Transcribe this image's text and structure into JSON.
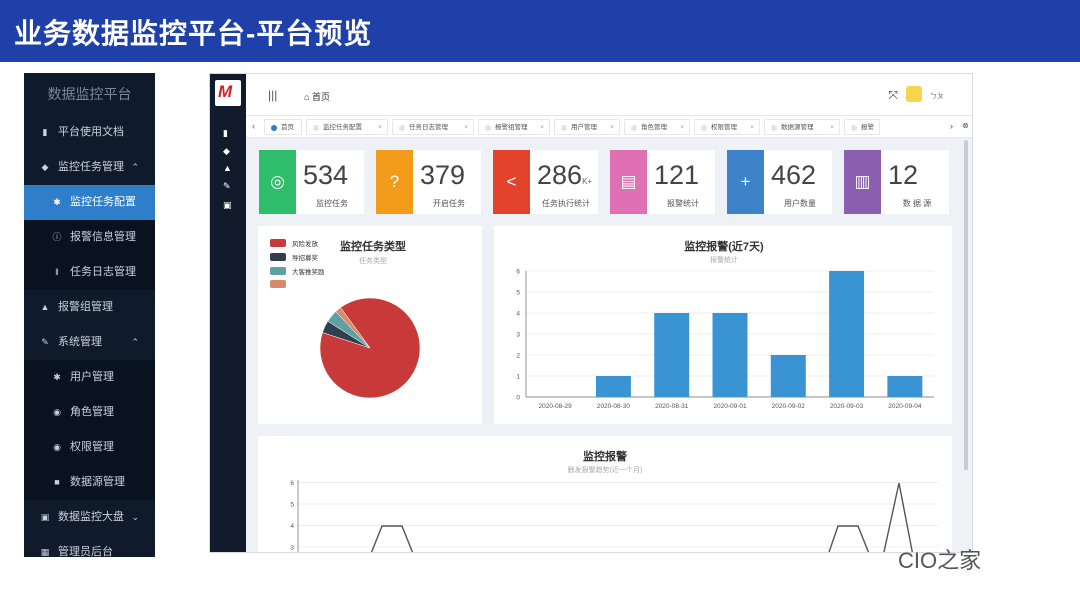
{
  "slide": {
    "title": "业务数据监控平台-平台预览"
  },
  "sidebar": {
    "brand": "数据监控平台",
    "items": [
      {
        "label": "平台使用文档",
        "icon": "book-icon",
        "level": 0
      },
      {
        "label": "监控任务管理",
        "icon": "layers-icon",
        "level": 0,
        "caret": "^"
      },
      {
        "label": "监控任务配置",
        "icon": "gear-icon",
        "level": 1,
        "active": true
      },
      {
        "label": "报警信息管理",
        "icon": "info-icon",
        "level": 1
      },
      {
        "label": "任务日志管理",
        "icon": "log-icon",
        "level": 1
      },
      {
        "label": "报警组管理",
        "icon": "bell-icon",
        "level": 0
      },
      {
        "label": "系统管理",
        "icon": "wrench-icon",
        "level": 0,
        "caret": "^"
      },
      {
        "label": "用户管理",
        "icon": "gear-icon",
        "level": 1
      },
      {
        "label": "角色管理",
        "icon": "users-icon",
        "level": 1
      },
      {
        "label": "权限管理",
        "icon": "users-icon",
        "level": 1
      },
      {
        "label": "数据源管理",
        "icon": "lock-icon",
        "level": 1
      },
      {
        "label": "数据监控大盘",
        "icon": "chart-icon",
        "level": 0,
        "caret": "v"
      },
      {
        "label": "管理员后台",
        "icon": "grid-icon",
        "level": 0
      }
    ]
  },
  "app": {
    "home": "首页",
    "user": "ㄅㄆ",
    "tabs": [
      {
        "label": "首页",
        "active": true
      },
      {
        "label": "监控任务配置"
      },
      {
        "label": "任务日志管理"
      },
      {
        "label": "报警组管理"
      },
      {
        "label": "用户管理"
      },
      {
        "label": "角色管理"
      },
      {
        "label": "权限管理"
      },
      {
        "label": "数据源管理"
      },
      {
        "label": "报警"
      }
    ],
    "stats": [
      {
        "value": "534",
        "suffix": "",
        "label": "监控任务",
        "color": "#2ebd6b",
        "icon": "target-icon"
      },
      {
        "value": "379",
        "suffix": "",
        "label": "开启任务",
        "color": "#f39c1b",
        "icon": "question-icon"
      },
      {
        "value": "286",
        "suffix": "K+",
        "label": "任务执行统计",
        "color": "#e2432a",
        "icon": "share-icon"
      },
      {
        "value": "121",
        "suffix": "",
        "label": "报警统计",
        "color": "#e070b4",
        "icon": "message-icon"
      },
      {
        "value": "462",
        "suffix": "",
        "label": "用户数量",
        "color": "#3c83c9",
        "icon": "add-user-icon"
      },
      {
        "value": "12",
        "suffix": "",
        "label": "数 据 源",
        "color": "#8a5fb1",
        "icon": "map-icon"
      }
    ]
  },
  "chart_data": [
    {
      "type": "pie",
      "title": "监控任务类型",
      "subtitle": "任务类型",
      "legend": [
        "风险发放",
        "导招募奖",
        "大客推奖励",
        ""
      ],
      "colors": [
        "#c83a3a",
        "#2f3f4e",
        "#5fa0a3",
        "#d98a6a"
      ],
      "values": [
        90,
        4,
        4,
        2
      ]
    },
    {
      "type": "bar",
      "title": "监控报警(近7天)",
      "subtitle": "报警统计",
      "categories": [
        "2020-08-29",
        "2020-08-30",
        "2020-08-31",
        "2020-09-01",
        "2020-09-02",
        "2020-09-03",
        "2020-09-04"
      ],
      "values": [
        0,
        1,
        4,
        4,
        2,
        6,
        1
      ],
      "ylim": [
        0,
        6
      ],
      "color": "#3a94d4"
    },
    {
      "type": "line",
      "title": "监控报警",
      "subtitle": "触发报警趋势(近一个月)",
      "yticks": [
        3,
        4,
        5,
        6
      ],
      "visible": true
    }
  ],
  "watermark": "CIO之家"
}
